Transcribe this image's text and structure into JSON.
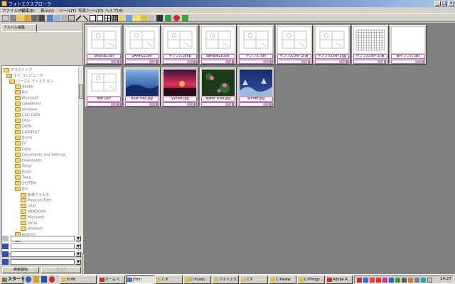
{
  "window": {
    "title": "フォトエクスプローラ"
  },
  "menu": [
    "ファイル(F)",
    "編集(E)",
    "表示(V)",
    "ツール(T)",
    "写真ツール(P)",
    "ヘルプ(H)"
  ],
  "left_panel": {
    "tab_label": "アルバム編集",
    "tree_items": [
      "デスクトップ",
      "マイ コンピュータ",
      "ローカル ディスク (C:)",
      "Adobe",
      "Bin",
      "Microsoft",
      "cakeBread",
      "windows",
      "CAD-DATA",
      "DOS",
      "DATA",
      "CATAPULT",
      "Bcom",
      "Di",
      "Data",
      "Documents and Settings",
      "Downloads",
      "Temp",
      "Nodir",
      "Tools",
      "SYSTEM",
      "Bin",
      "新規フォルダ",
      "Program Files",
      "ntldr",
      "WINDOWS",
      "Microsoft",
      "temp",
      "ntdetect",
      "boot.ini",
      "RECYCLER",
      "System Volume"
    ],
    "search_button": "検索開始",
    "clear_button": "クリア"
  },
  "thumbnails": [
    {
      "name": "3menzu.dxf",
      "kind": "drawing"
    },
    {
      "name": "SAMPLE.dxf",
      "kind": "drawing"
    },
    {
      "name": "サンプル.bmp",
      "kind": "drawing"
    },
    {
      "name": "sample2d.dxf",
      "kind": "drawing"
    },
    {
      "name": "サンプル.dxf",
      "kind": "drawing"
    },
    {
      "name": "サンプルDXF-2(表",
      "kind": "drawing"
    },
    {
      "name": "サンプルDXF-3(図",
      "kind": "drawing"
    },
    {
      "name": "サンプルDXF-1(表",
      "kind": "table"
    },
    {
      "name": "表サンプル.dxf",
      "kind": "blank"
    },
    {
      "name": "test.DXF",
      "kind": "drawing"
    },
    {
      "name": "Blue hills.jpg",
      "kind": "photo-blue"
    },
    {
      "name": "Sunset.jpg",
      "kind": "photo-sunset"
    },
    {
      "name": "Water lilies.jpg",
      "kind": "photo-lilies"
    },
    {
      "name": "Winter.jpg",
      "kind": "photo-winter"
    }
  ],
  "taskbar": {
    "start_label": "スタート",
    "tasks": [
      "H:¥6",
      "ホームペ...",
      "JTrim",
      "C:¥",
      "C:¥cadc...",
      "フォトエクス...",
      "C:¥",
      "C:¥www",
      "C:¥Progr...",
      "Adobe A..."
    ],
    "clock": "14:27"
  },
  "colors": {
    "title_start": "#0a246a",
    "title_end": "#a6caf0",
    "caption_border": "#c060c0",
    "folder": "#f2d27a",
    "desktop_bg": "#808080"
  }
}
